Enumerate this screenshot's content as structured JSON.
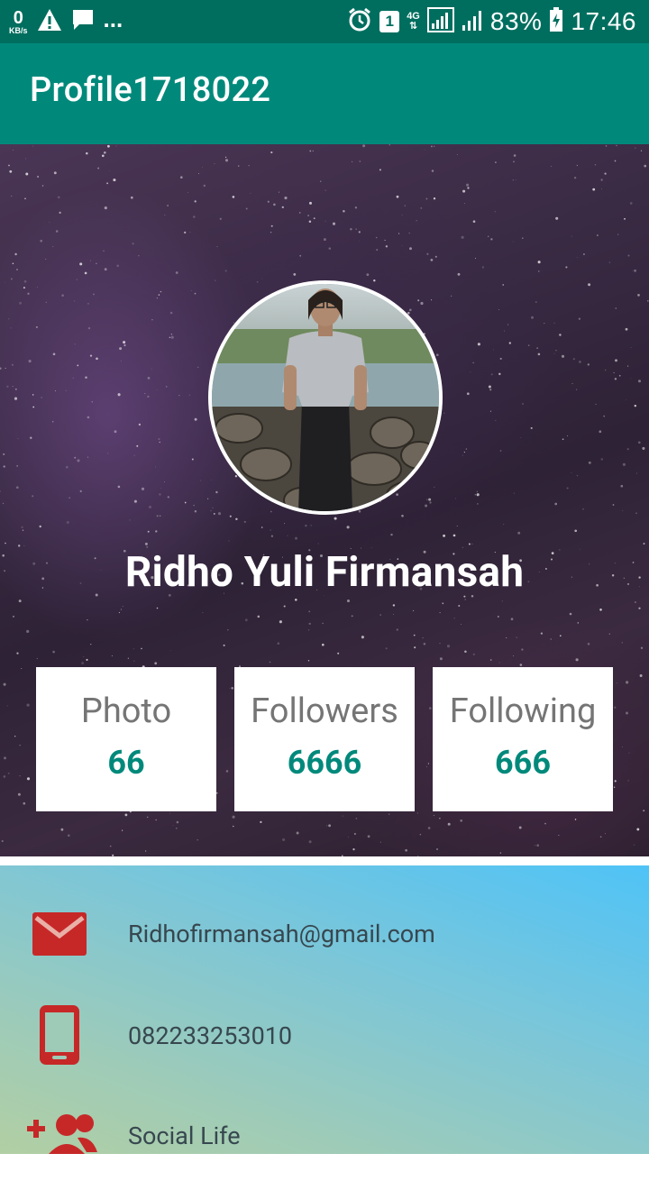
{
  "status_bar": {
    "speed_value": "0",
    "speed_unit": "KB/s",
    "more": "...",
    "sim_slot": "1",
    "network": "4G",
    "battery": "83%",
    "time": "17:46"
  },
  "app_bar": {
    "title": "Profile1718022"
  },
  "profile": {
    "name": "Ridho Yuli Firmansah"
  },
  "stats": [
    {
      "label": "Photo",
      "value": "66"
    },
    {
      "label": "Followers",
      "value": "6666"
    },
    {
      "label": "Following",
      "value": "666"
    }
  ],
  "contacts": [
    {
      "icon": "email-icon",
      "text": "Ridhofirmansah@gmail.com"
    },
    {
      "icon": "phone-icon",
      "text": "082233253010"
    },
    {
      "icon": "add-group-icon",
      "text": "Social Life"
    }
  ],
  "colors": {
    "primary": "#00897b",
    "primary_dark": "#006e5f",
    "icon_red": "#c62828"
  }
}
